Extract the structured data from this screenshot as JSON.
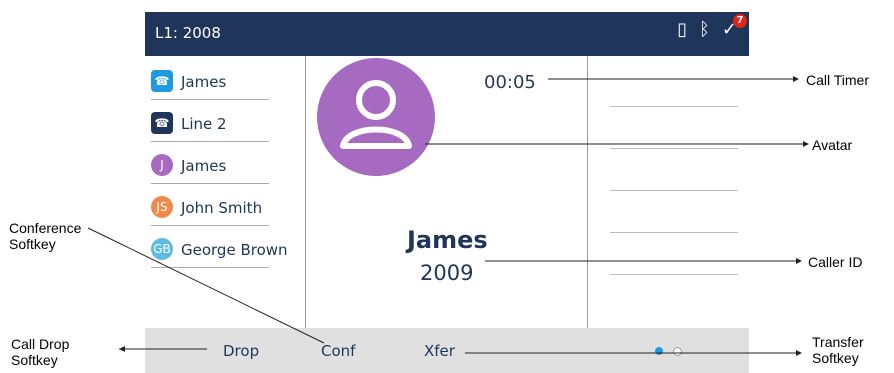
{
  "phone": {
    "line_label": "L1: 2008",
    "badge_count": "7",
    "call_list": [
      {
        "label": "James",
        "icon": "phone-icon",
        "color": "#1e9be0"
      },
      {
        "label": "Line 2",
        "icon": "phone-icon",
        "color": "#1f3559"
      },
      {
        "label": "James",
        "initials": "J",
        "color": "#a66bc1"
      },
      {
        "label": "John Smith",
        "initials": "JS",
        "color": "#f08a4b"
      },
      {
        "label": "George Brown",
        "initials": "GB",
        "color": "#5bbbe6"
      }
    ],
    "timer": "00:05",
    "caller_name": "James",
    "caller_number": "2009",
    "softkeys": {
      "drop": "Drop",
      "conf": "Conf",
      "xfer": "Xfer"
    }
  },
  "callouts": {
    "call_timer": "Call Timer",
    "avatar": "Avatar",
    "caller_id": "Caller ID",
    "conference_1": "Conference",
    "conference_2": "Softkey",
    "drop_1": "Call Drop",
    "drop_2": "Softkey",
    "transfer_1": "Transfer",
    "transfer_2": "Softkey"
  }
}
